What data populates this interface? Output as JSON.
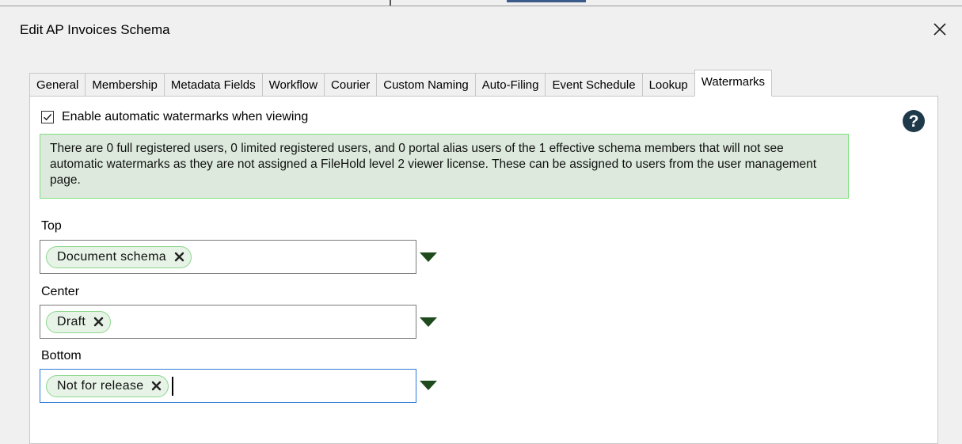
{
  "window": {
    "title": "Edit AP Invoices Schema"
  },
  "tabs": [
    {
      "label": "General"
    },
    {
      "label": "Membership"
    },
    {
      "label": "Metadata Fields"
    },
    {
      "label": "Workflow"
    },
    {
      "label": "Courier"
    },
    {
      "label": "Custom Naming"
    },
    {
      "label": "Auto-Filing"
    },
    {
      "label": "Event Schedule"
    },
    {
      "label": "Lookup"
    },
    {
      "label": "Watermarks"
    }
  ],
  "active_tab": "Watermarks",
  "enable_checkbox": {
    "label": "Enable automatic watermarks when viewing",
    "checked": true
  },
  "notice": {
    "text": "There are 0 full registered users, 0 limited registered users, and 0 portal alias users of the 1 effective  schema members that will not see automatic watermarks as they are not assigned a FileHold level 2 viewer license. These can be assigned to users from the user management page."
  },
  "fields": {
    "top": {
      "label": "Top",
      "tag": "Document schema"
    },
    "center": {
      "label": "Center",
      "tag": "Draft"
    },
    "bottom": {
      "label": "Bottom",
      "tag": "Not for release"
    }
  },
  "colors": {
    "notice_bg": "#dce9dc",
    "notice_border": "#7de07d",
    "chip_border": "#8ed78e",
    "dropdown_arrow": "#1e4a1e",
    "help_icon": "#1e3a4a",
    "focus_border": "#2c7ad6"
  },
  "icons": {
    "close": "close-icon",
    "help": "help-icon",
    "dropdown": "dropdown-arrow-icon",
    "chip_remove": "remove-x-icon",
    "checkbox": "checkmark-icon"
  }
}
